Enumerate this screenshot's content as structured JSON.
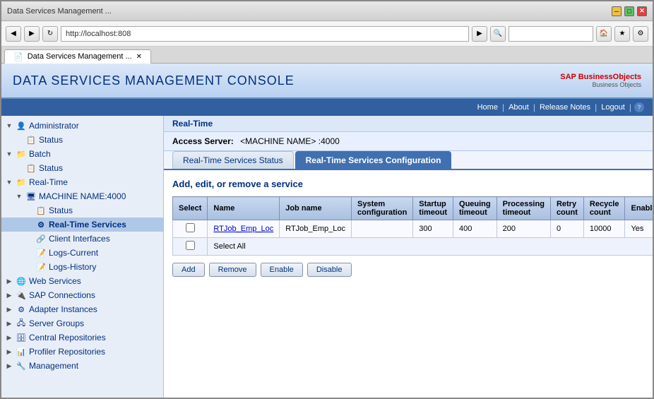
{
  "browser": {
    "address": "http://localhost:808",
    "tab_title": "Data Services Management ...",
    "home_icon": "🏠",
    "back_icon": "◀",
    "forward_icon": "▶",
    "refresh_icon": "↻",
    "stop_icon": "✕",
    "favicon": "📄"
  },
  "header": {
    "title": "DATA SERVICES",
    "title_sub": " MANAGEMENT CONSOLE",
    "sap_brand": "SAP BusinessObjects"
  },
  "top_nav": {
    "home": "Home",
    "about": "About",
    "release_notes": "Release Notes",
    "logout": "Logout",
    "help": "?"
  },
  "sidebar": {
    "user": "Administrator",
    "items": [
      {
        "label": "Administrator",
        "level": 0,
        "expanded": true,
        "icon": "👤"
      },
      {
        "label": "Status",
        "level": 1,
        "icon": "📋"
      },
      {
        "label": "Batch",
        "level": 0,
        "expanded": true,
        "icon": "📁"
      },
      {
        "label": "Status",
        "level": 1,
        "icon": "📋"
      },
      {
        "label": "Real-Time",
        "level": 0,
        "expanded": true,
        "icon": "📁"
      },
      {
        "label": "MACHINE NAME:4000",
        "level": 1,
        "expanded": true,
        "icon": "🖥"
      },
      {
        "label": "Status",
        "level": 2,
        "icon": "📋"
      },
      {
        "label": "Real-Time Services",
        "level": 2,
        "icon": "⚙",
        "selected": true
      },
      {
        "label": "Client Interfaces",
        "level": 2,
        "icon": "🔗"
      },
      {
        "label": "Logs-Current",
        "level": 2,
        "icon": "📝"
      },
      {
        "label": "Logs-History",
        "level": 2,
        "icon": "📝"
      },
      {
        "label": "Web Services",
        "level": 0,
        "expanded": false,
        "icon": "🌐"
      },
      {
        "label": "SAP Connections",
        "level": 0,
        "expanded": false,
        "icon": "🔌"
      },
      {
        "label": "Adapter Instances",
        "level": 0,
        "expanded": false,
        "icon": "⚙"
      },
      {
        "label": "Server Groups",
        "level": 0,
        "expanded": false,
        "icon": "🖧"
      },
      {
        "label": "Central Repositories",
        "level": 0,
        "expanded": false,
        "icon": "🗄"
      },
      {
        "label": "Profiler Repositories",
        "level": 0,
        "expanded": false,
        "icon": "📊"
      },
      {
        "label": "Management",
        "level": 0,
        "expanded": false,
        "icon": "🔧"
      }
    ]
  },
  "breadcrumb": "Real-Time",
  "access_server": {
    "label": "Access Server:",
    "value": "<MACHINE NAME> :4000"
  },
  "tabs": [
    {
      "label": "Real-Time Services Status",
      "active": false
    },
    {
      "label": "Real-Time Services Configuration",
      "active": true
    }
  ],
  "content": {
    "title": "Add, edit, or remove a service",
    "table": {
      "headers": [
        "Select",
        "Name",
        "Job name",
        "System configuration",
        "Startup timeout",
        "Queuing timeout",
        "Processing timeout",
        "Retry count",
        "Recycle count",
        "Enabled"
      ],
      "rows": [
        {
          "select": "",
          "name": "RTJob_Emp_Loc",
          "job_name": "RTJob_Emp_Loc",
          "system_configuration": "",
          "startup_timeout": "300",
          "queuing_timeout": "400",
          "processing_timeout": "200",
          "retry_count": "0",
          "recycle_count": "10000",
          "enabled": "Yes"
        }
      ],
      "select_all_label": "Select All"
    },
    "buttons": {
      "add": "Add",
      "remove": "Remove",
      "enable": "Enable",
      "disable": "Disable"
    }
  }
}
